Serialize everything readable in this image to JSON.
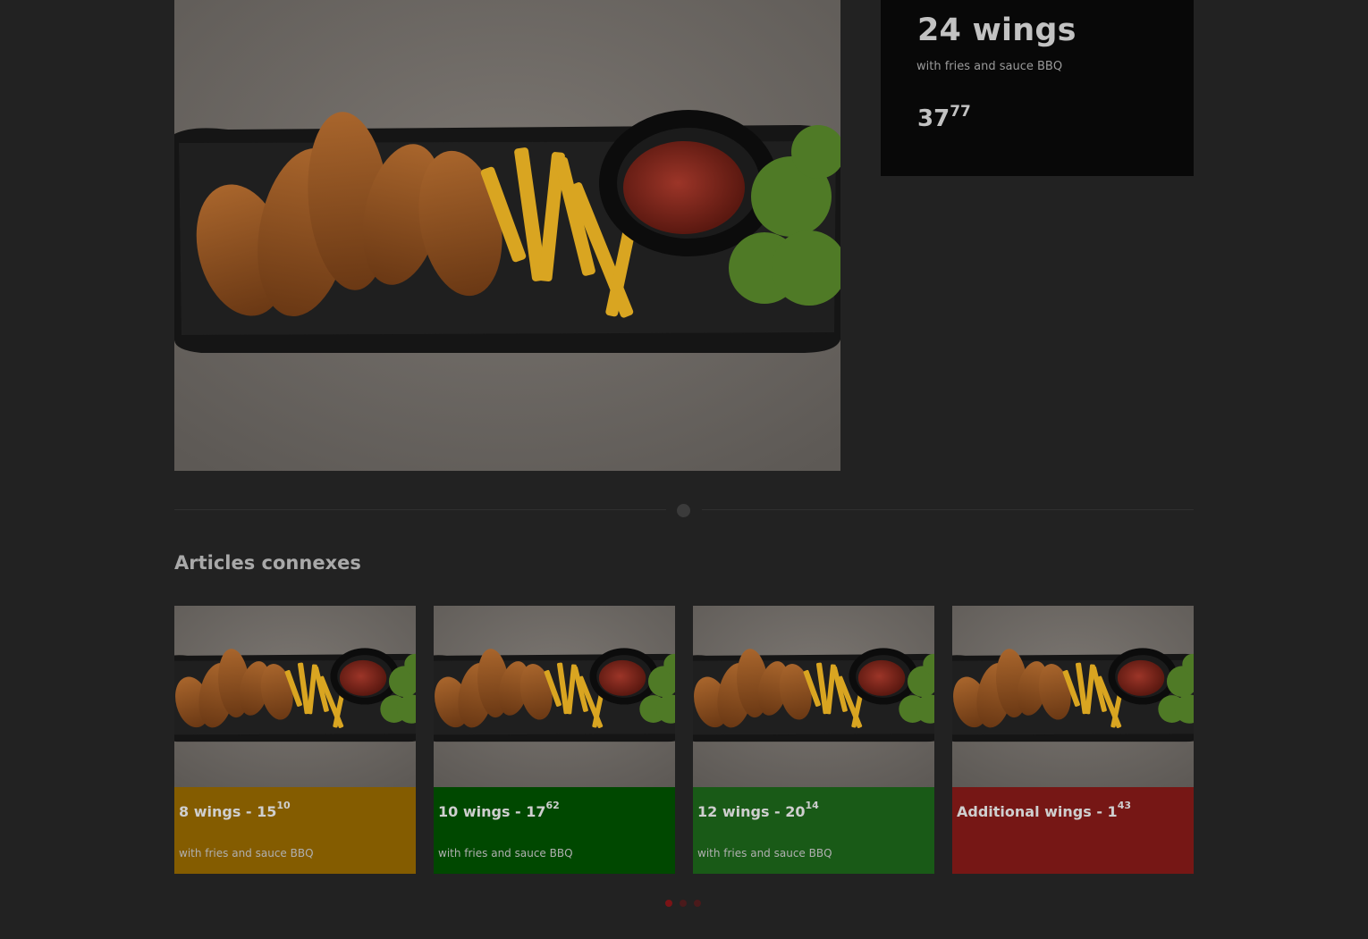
{
  "product": {
    "title": "24 wings",
    "subtitle": "with fries and sauce BBQ",
    "price_main": "37",
    "price_cents": "77"
  },
  "related": {
    "title": "Articles connexes",
    "items": [
      {
        "name": "8 wings - 15",
        "cents": "10",
        "description": "with fries and sauce BBQ",
        "color": "#845c00"
      },
      {
        "name": "10 wings - 17",
        "cents": "62",
        "description": "with fries and sauce BBQ",
        "color": "#004800"
      },
      {
        "name": "12 wings - 20",
        "cents": "14",
        "description": "with fries and sauce BBQ",
        "color": "#195a17"
      },
      {
        "name": "Additional wings - 1",
        "cents": "43",
        "description": "",
        "color": "#761715"
      }
    ]
  },
  "carousel": {
    "dots": [
      {
        "active": true,
        "color": "#7a1316"
      },
      {
        "active": false,
        "color": "#4a1a1b"
      },
      {
        "active": false,
        "color": "#4a1a1b"
      }
    ]
  }
}
